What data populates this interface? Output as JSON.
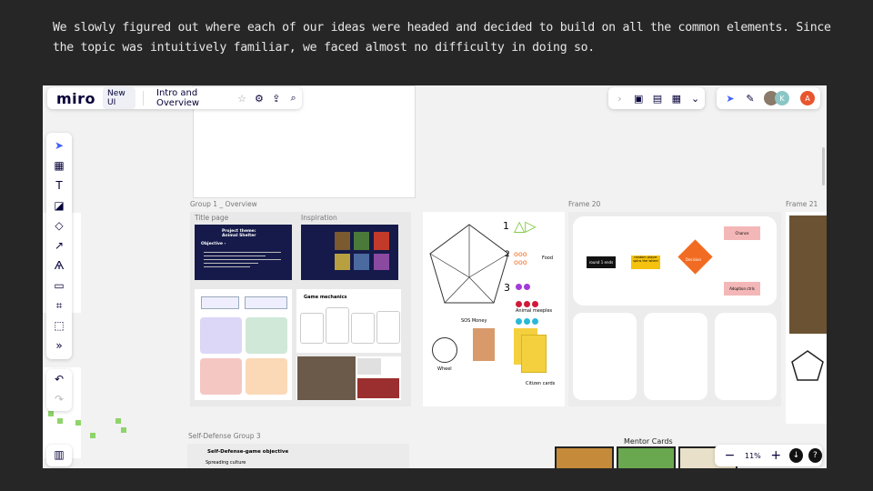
{
  "caption": "We slowly figured out where each of our ideas were headed and decided to build on all the common elements. Since the topic was intuitively familiar, we faced almost no difficulty in doing so.",
  "header": {
    "logo": "miro",
    "badge": "New UI",
    "board_title": "Intro and Overview"
  },
  "avatars": [
    "K",
    "A"
  ],
  "groups": {
    "group1": "Group 1 _ Overview",
    "title_page": "Title page",
    "inspiration": "Inspiration",
    "frame20": "Frame 20",
    "frame21": "Frame 21",
    "self_defense": "Self-Defense Group 3",
    "mentor_cards": "Mentor Cards"
  },
  "title_slide": {
    "heading": "Project theme:\nAnimal Shelter",
    "objective": "Objective -"
  },
  "game_mechanics": "Game mechanics",
  "pentagon_labels": {
    "sos": "SOS Money",
    "food": "Food",
    "animal_meeples": "Animal meeples",
    "wheel": "Wheel",
    "citizen_cards": "Citizen cards",
    "n1": "1",
    "n2": "2",
    "n3": "3"
  },
  "flow": {
    "round": "round 1 ends",
    "spin": "random player spins the wheel",
    "decision": "Decision",
    "chance": "Chance",
    "adoption": "Adoption ctrls"
  },
  "self_defense_title": "Self-Defense-game objective",
  "self_defense_bullet": "Spreading culture",
  "zoom": {
    "level": "11%",
    "minus": "−",
    "plus": "+"
  },
  "colors": {
    "navy": "#151a4a",
    "orange": "#f26b22",
    "yellow": "#f4d03f",
    "pink_sticky": "#f4c7c3",
    "lilac_sticky": "#dcd6f7",
    "green_sticky": "#cfe8d8",
    "peach_sticky": "#fbd9b6"
  }
}
